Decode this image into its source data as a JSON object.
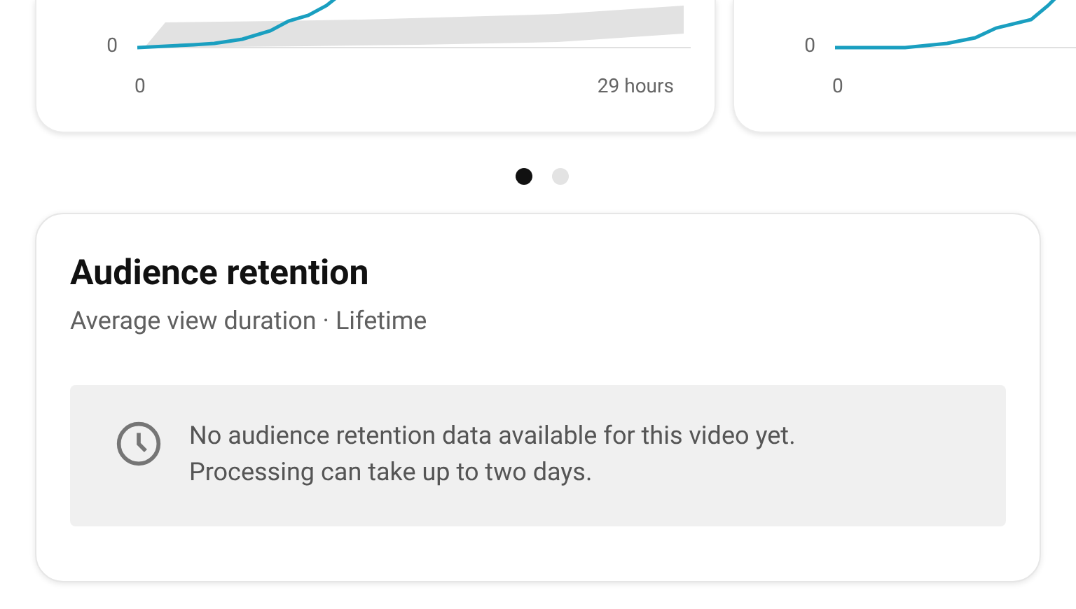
{
  "carousel": {
    "cards": [
      {
        "y_axis_label": "0",
        "x_start_label": "0",
        "x_end_label": "29 hours",
        "show_band": true
      },
      {
        "y_axis_label": "0",
        "x_start_label": "0",
        "show_band": false
      }
    ],
    "dots": [
      {
        "selected": true
      },
      {
        "selected": false
      }
    ]
  },
  "retention": {
    "title": "Audience retention",
    "subtitle": "Average view duration · Lifetime",
    "notice": {
      "lines": [
        "No audience retention data available for this video yet.",
        "Processing can take up to two days."
      ]
    }
  }
}
